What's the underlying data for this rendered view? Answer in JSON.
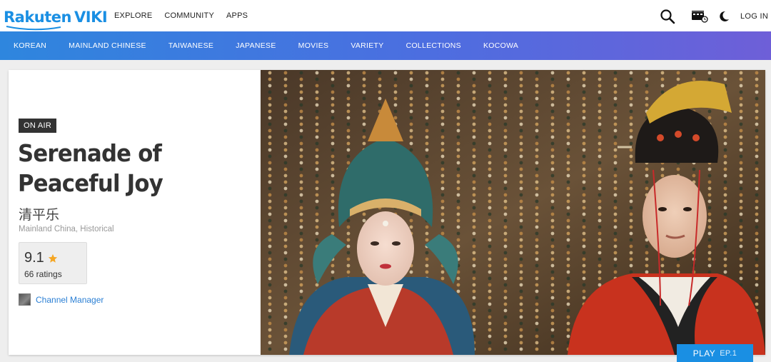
{
  "header": {
    "logo": {
      "brand": "Rakuten",
      "product": "VIKI"
    },
    "nav": [
      "EXPLORE",
      "COMMUNITY",
      "APPS"
    ],
    "icons": [
      "search-icon",
      "cast-icon",
      "moon-icon"
    ],
    "login_label": "LOG IN"
  },
  "genres": [
    "KOREAN",
    "MAINLAND CHINESE",
    "TAIWANESE",
    "JAPANESE",
    "MOVIES",
    "VARIETY",
    "COLLECTIONS",
    "KOCOWA"
  ],
  "hero": {
    "badge": "ON AIR",
    "title": "Serenade of Peaceful Joy",
    "native_title": "清平乐",
    "meta": "Mainland China, Historical",
    "rating": {
      "value": "9.1",
      "count_label": "66 ratings"
    },
    "channel": "Channel Manager",
    "play": {
      "label": "PLAY",
      "episode": "EP.1"
    }
  },
  "colors": {
    "brand_blue": "#1a8fe3",
    "genre_bar_start": "#2e86de",
    "genre_bar_end": "#6e5fd8",
    "star": "#f5a623"
  }
}
